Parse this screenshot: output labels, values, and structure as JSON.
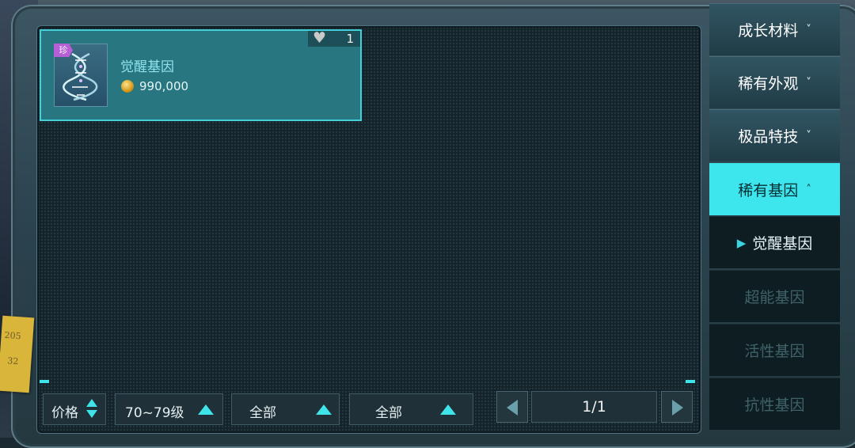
{
  "item": {
    "rarity_tag": "珍",
    "name": "觉醒基因",
    "price": "990,000",
    "favorite_count": "1"
  },
  "menu": {
    "categories": [
      {
        "label": "成长材料",
        "chevron": "˅"
      },
      {
        "label": "稀有外观",
        "chevron": "˅"
      },
      {
        "label": "极品特技",
        "chevron": "˅"
      },
      {
        "label": "稀有基因",
        "chevron": "˄"
      }
    ],
    "subitems": [
      {
        "label": "觉醒基因"
      },
      {
        "label": "超能基因"
      },
      {
        "label": "活性基因"
      },
      {
        "label": "抗性基因"
      }
    ],
    "selected_marker": "▶"
  },
  "filters": {
    "sort_label": "价格",
    "level_range": "70~79级",
    "filter_a": "全部",
    "filter_b": "全部"
  },
  "pagination": {
    "page": "1/1"
  },
  "colors": {
    "accent": "#3ce6ec",
    "card": "#277680",
    "rare_tag": "#b75fd6"
  },
  "icons": [
    "heart-icon",
    "coin-icon",
    "dna-icon",
    "chevron-down-icon",
    "chevron-up-icon",
    "triangle-up-icon",
    "arrow-left-icon",
    "arrow-right-icon"
  ]
}
